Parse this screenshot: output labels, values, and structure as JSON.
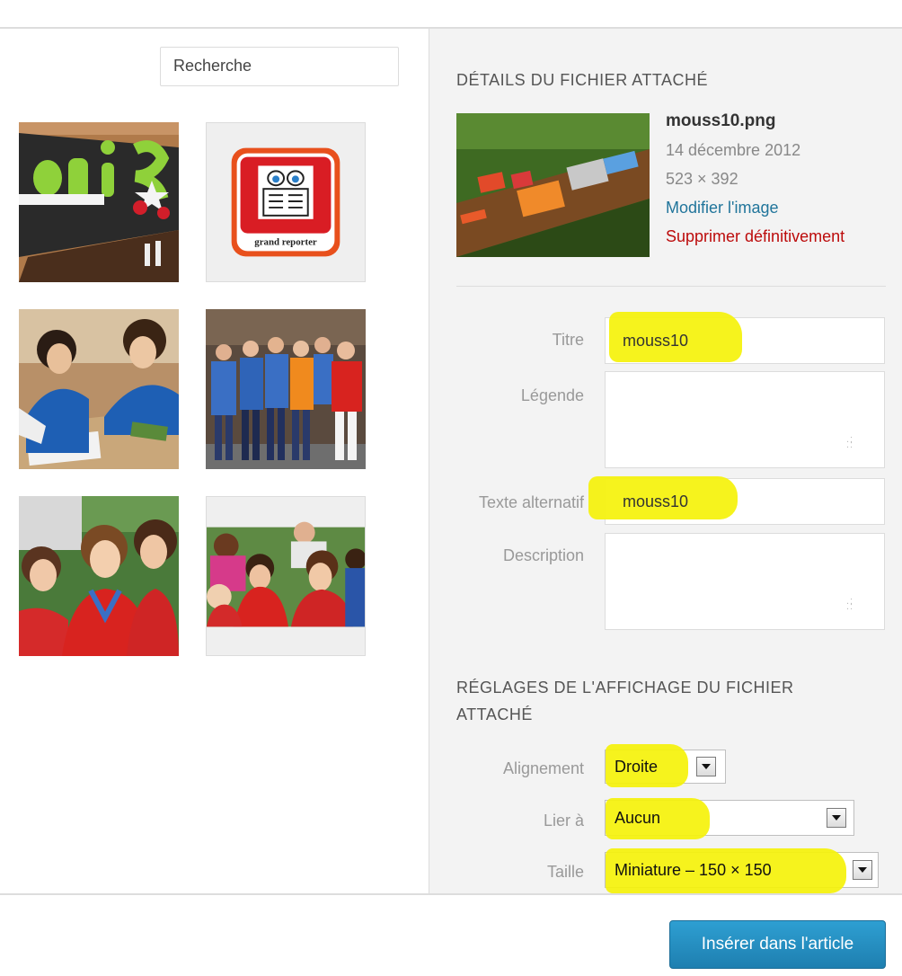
{
  "search": {
    "placeholder": "Recherche"
  },
  "library": {
    "thumbnails": [
      {
        "name": "louis-letters-thumb"
      },
      {
        "name": "grand-reporter-thumb",
        "label": "grand reporter"
      },
      {
        "name": "girls-writing-thumb"
      },
      {
        "name": "group-photo-thumb"
      },
      {
        "name": "girls-red-shirts-thumb"
      },
      {
        "name": "group-sitting-thumb"
      }
    ]
  },
  "details": {
    "heading": "DÉTAILS DU FICHIER ATTACHÉ",
    "filename": "mouss10.png",
    "date": "14 décembre 2012",
    "dimensions": "523 × 392",
    "edit_link": "Modifier l'image",
    "delete_link": "Supprimer définitivement"
  },
  "fields": {
    "title_label": "Titre",
    "title_value": "mouss10",
    "caption_label": "Légende",
    "caption_value": "",
    "alt_label": "Texte alternatif",
    "alt_value": "mouss10",
    "description_label": "Description",
    "description_value": ""
  },
  "display": {
    "heading_line1": "RÉGLAGES DE L'AFFICHAGE DU FICHIER",
    "heading_line2": "ATTACHÉ",
    "alignment_label": "Alignement",
    "alignment_value": "Droite",
    "link_label": "Lier à",
    "link_value": "Aucun",
    "size_label": "Taille",
    "size_value": "Miniature – 150 × 150"
  },
  "footer": {
    "insert_button": "Insérer dans l'article"
  },
  "colors": {
    "highlight": "#f5f20a",
    "button": "#2e9fd2",
    "link": "#21759b",
    "delete": "#bc0b0b"
  }
}
